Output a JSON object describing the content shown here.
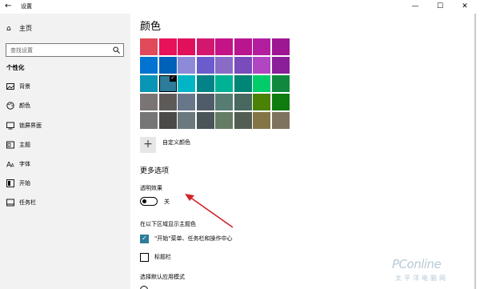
{
  "window": {
    "title": "设置",
    "back_icon": "back-arrow-icon",
    "min_glyph": "—",
    "max_glyph": "☐",
    "close_glyph": "✕"
  },
  "sidebar": {
    "home": {
      "label": "主页",
      "icon": "home-icon"
    },
    "search": {
      "placeholder": "查找设置",
      "icon": "search-icon"
    },
    "section_title": "个性化",
    "items": [
      {
        "label": "背景",
        "icon": "picture-icon"
      },
      {
        "label": "颜色",
        "icon": "palette-icon"
      },
      {
        "label": "锁屏界面",
        "icon": "lock-screen-icon"
      },
      {
        "label": "主题",
        "icon": "theme-icon"
      },
      {
        "label": "字体",
        "icon": "font-icon"
      },
      {
        "label": "开始",
        "icon": "start-icon"
      },
      {
        "label": "任务栏",
        "icon": "taskbar-icon"
      }
    ]
  },
  "main": {
    "heading": "颜色",
    "palette_colors": [
      [
        "#e04a5b",
        "#e8125a",
        "#e0105c",
        "#d3176f",
        "#c41488",
        "#b8158f",
        "#b31ea0",
        "#9e1693"
      ],
      [
        "#0074d0",
        "#0061b8",
        "#8d8bd8",
        "#6a5ccc",
        "#886cc6",
        "#7a4bba",
        "#b146c2",
        "#8b1f9a"
      ],
      [
        "#0a94b6",
        "#2d7d9a",
        "#00b6c6",
        "#038387",
        "#00b294",
        "#018574",
        "#00cc6a",
        "#10893e"
      ],
      [
        "#7a7574",
        "#5d5a58",
        "#68768a",
        "#515c6b",
        "#567c73",
        "#486860",
        "#498205",
        "#107c10"
      ],
      [
        "#767676",
        "#4c4a48",
        "#69797e",
        "#4a5459",
        "#647c64",
        "#525e54",
        "#847545",
        "#7e735f"
      ]
    ],
    "selected_color": {
      "row": 2,
      "col": 1
    },
    "custom_color_label": "自定义颜色",
    "more_options_heading": "更多选项",
    "transparency_label": "透明效果",
    "transparency_state": "关",
    "accent_surfaces_label": "在以下区域显示主题色",
    "checkbox_start": "\"开始\"菜单、任务栏和操作中心",
    "checkbox_start_checked": true,
    "checkbox_titlebar": "标题栏",
    "checkbox_titlebar_checked": false,
    "app_mode_label": "选择默认应用模式"
  },
  "watermark": {
    "brand": "PConline",
    "cn": "太平洋电脑网"
  },
  "colors": {
    "accent": "#2d7d9a",
    "sidebar_bg": "#f2f2f2",
    "arrow": "#d2232a"
  }
}
